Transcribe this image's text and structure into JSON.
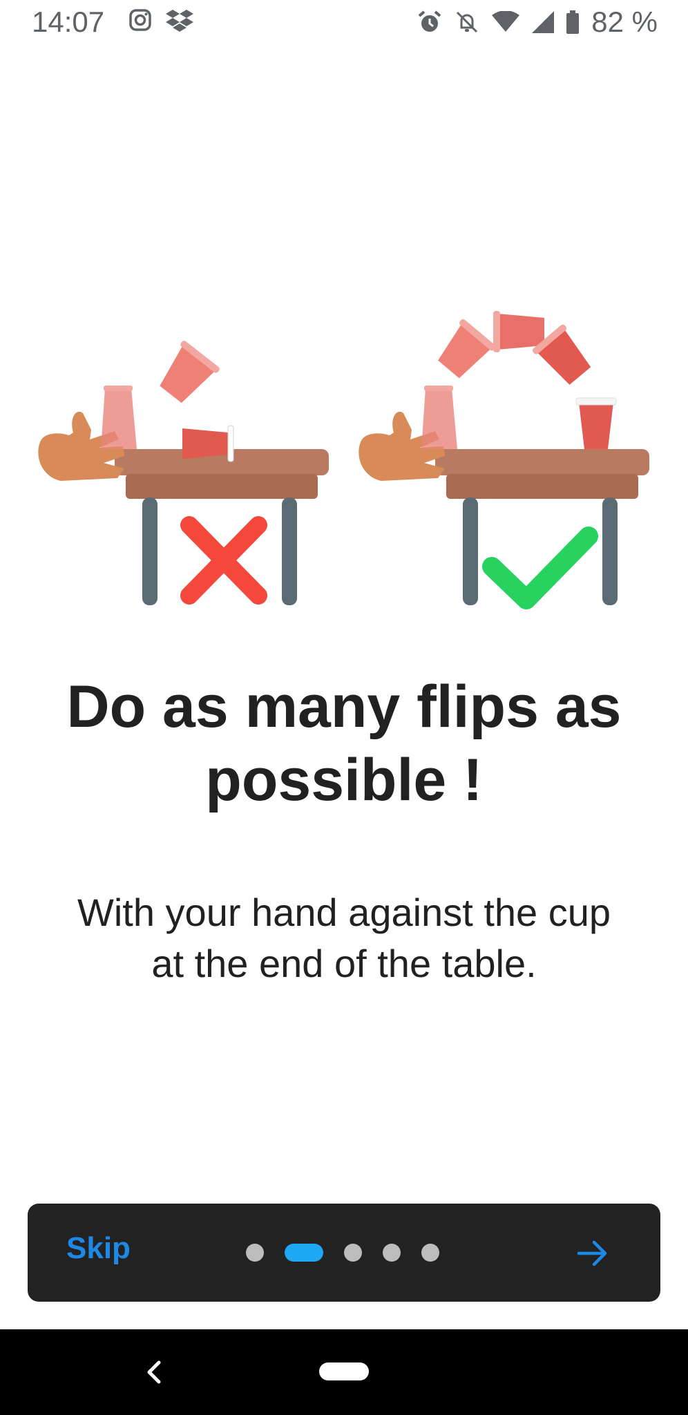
{
  "status_bar": {
    "time": "14:07",
    "battery_percent": "82 %",
    "left_icons": [
      "instagram-icon",
      "dropbox-icon"
    ],
    "right_icons": [
      "alarm-icon",
      "notifications-off-icon",
      "wifi-icon",
      "signal-icon",
      "battery-icon"
    ]
  },
  "onboarding": {
    "title": "Do as many flips as possible !",
    "subtitle": "With your hand against the cup at the end of the table.",
    "illustration": {
      "left_panel_icon": "cross-icon",
      "right_panel_icon": "check-icon"
    },
    "colors": {
      "cup": "#e25a4f",
      "table": "#a86b52",
      "cross": "#f4483c",
      "check": "#27d25f",
      "accent": "#1ea7f2"
    }
  },
  "bottom_bar": {
    "skip_label": "Skip",
    "page_count": 5,
    "active_page": 2,
    "next_icon": "arrow-right-icon"
  },
  "nav_bar": {
    "back_icon": "back-icon",
    "home_icon": "home-pill-icon"
  }
}
